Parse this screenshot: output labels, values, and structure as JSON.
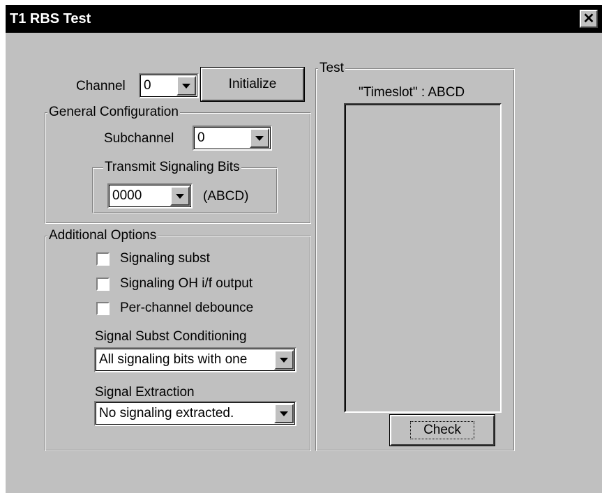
{
  "window": {
    "title": "T1 RBS Test",
    "close_label": "✕"
  },
  "channel": {
    "label": "Channel",
    "value": "0",
    "initialize_label": "Initialize"
  },
  "general_config": {
    "legend": "General Configuration",
    "subchannel_label": "Subchannel",
    "subchannel_value": "0",
    "transmit_legend": "Transmit Signaling Bits",
    "transmit_value": "0000",
    "transmit_suffix": "(ABCD)"
  },
  "additional_options": {
    "legend": "Additional Options",
    "checkboxes": [
      {
        "label": "Signaling subst",
        "checked": false
      },
      {
        "label": "Signaling OH i/f output",
        "checked": false
      },
      {
        "label": "Per-channel debounce",
        "checked": false
      }
    ],
    "subst_conditioning_label": "Signal Subst Conditioning",
    "subst_conditioning_value": "All signaling bits with one",
    "extraction_label": "Signal Extraction",
    "extraction_value": "No signaling extracted."
  },
  "test": {
    "legend": "Test",
    "column_header": "\"Timeslot\" : ABCD",
    "check_label": "Check"
  },
  "colors": {
    "face": "#c0c0c0",
    "titlebar": "#000000",
    "title_text": "#ffffff"
  }
}
